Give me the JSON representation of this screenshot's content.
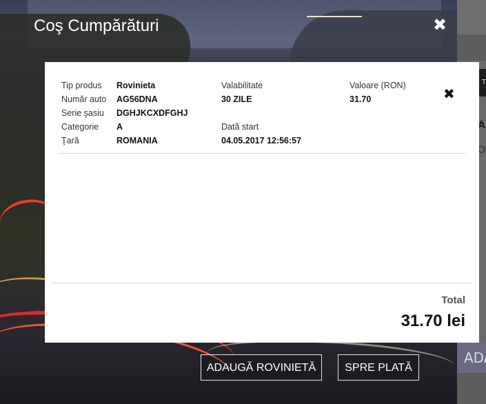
{
  "modal": {
    "title": "Coş Cumpărături",
    "close_icon": "✖"
  },
  "cart_item": {
    "labels": {
      "product_type": "Tip produs",
      "plate_number": "Număr auto",
      "chassis_series": "Serie şasiu",
      "category": "Categorie",
      "country": "Ţară",
      "validity": "Valabilitate",
      "start_date": "Dată start",
      "value": "Valoare (RON)"
    },
    "values": {
      "product_type": "Rovinieta",
      "plate_number": "AG56DNA",
      "chassis_series": "DGHJKCXDFGHJ",
      "category": "A",
      "country": "ROMANIA",
      "validity": "30 ZILE",
      "start_date": "04.05.2017 12:56:57",
      "value": "31.70"
    },
    "remove_icon": "✖"
  },
  "total": {
    "label": "Total",
    "value": "31.70 lei"
  },
  "buttons": {
    "add_vignette": "ADAUGĂ ROVINIETĂ",
    "to_payment": "SPRE PLATĂ"
  },
  "background_page": {
    "button_fragment": "ADA",
    "text_fragment_1": "AR",
    "text_fragment_2": "O",
    "header_fragment": "TI"
  }
}
